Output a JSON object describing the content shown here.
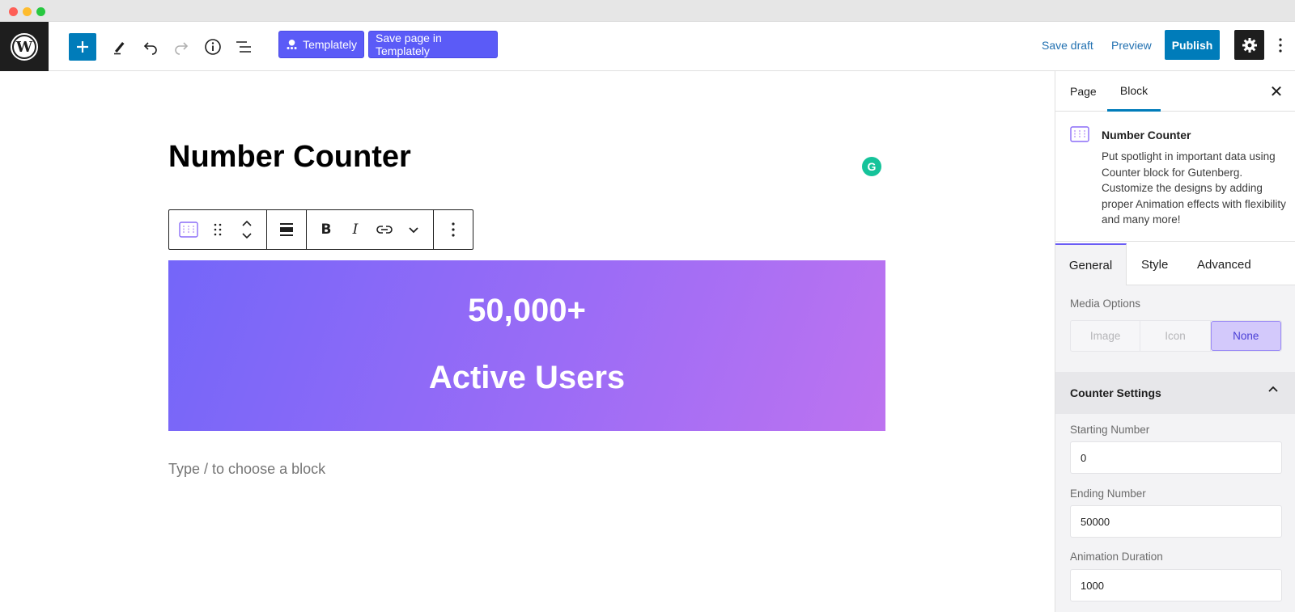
{
  "toolbar": {
    "templately_label": "Templately",
    "save_templately_label": "Save page in Templately",
    "save_draft_label": "Save draft",
    "preview_label": "Preview",
    "publish_label": "Publish",
    "brand_color": "#5b5bf7",
    "accent_color": "#007cba"
  },
  "editor": {
    "page_title": "Number Counter",
    "counter": {
      "number": "50,000+",
      "label": "Active Users",
      "gradient": [
        "#7466f9",
        "#bd73f0"
      ]
    },
    "placeholder": "Type / to choose a block",
    "grammarly_glyph": "G",
    "block_toolbar": {
      "bold": "B",
      "italic": "I"
    }
  },
  "sidebar": {
    "tabs": [
      {
        "label": "Page"
      },
      {
        "label": "Block"
      }
    ],
    "close_glyph": "✕",
    "block_card": {
      "title": "Number Counter",
      "description": "Put spotlight in important data using Counter block for Gutenberg. Customize the designs by adding proper Animation effects with flexibility and many more!"
    },
    "panel_tabs": [
      {
        "label": "General"
      },
      {
        "label": "Style"
      },
      {
        "label": "Advanced"
      }
    ],
    "media_options": {
      "label": "Media Options",
      "options": [
        "Image",
        "Icon",
        "None"
      ],
      "selected": "None"
    },
    "counter_settings": {
      "title": "Counter Settings",
      "starting_label": "Starting Number",
      "starting_value": "0",
      "ending_label": "Ending Number",
      "ending_value": "50000",
      "duration_label": "Animation Duration",
      "duration_value": "1000"
    }
  }
}
